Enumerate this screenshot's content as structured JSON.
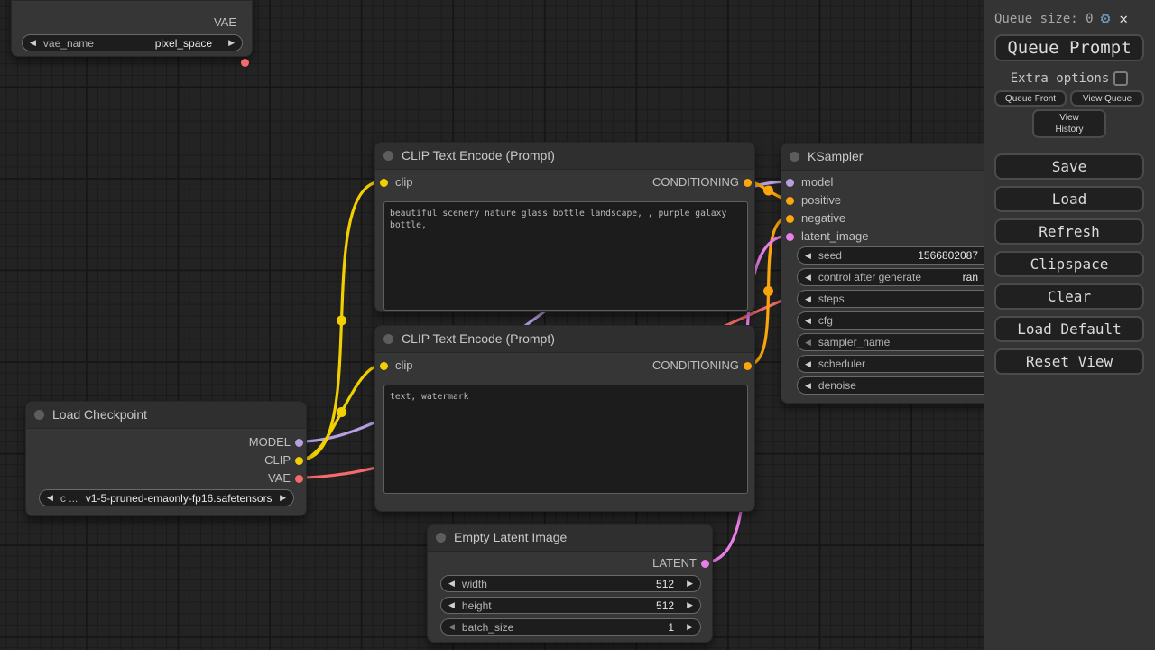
{
  "canvas": {
    "nodes": {
      "vae_loader": {
        "output_label": "VAE",
        "widget_label": "vae_name",
        "widget_value": "pixel_space"
      },
      "load_checkpoint": {
        "title": "Load Checkpoint",
        "output_model": "MODEL",
        "output_clip": "CLIP",
        "output_vae": "VAE",
        "widget_label": "c ...",
        "widget_value": "v1-5-pruned-emaonly-fp16.safetensors"
      },
      "clip_encode_positive": {
        "title": "CLIP Text Encode (Prompt)",
        "input_label": "clip",
        "output_label": "CONDITIONING",
        "text": "beautiful scenery nature glass bottle landscape, , purple galaxy bottle,"
      },
      "clip_encode_negative": {
        "title": "CLIP Text Encode (Prompt)",
        "input_label": "clip",
        "output_label": "CONDITIONING",
        "text": "text, watermark"
      },
      "ksampler": {
        "title": "KSampler",
        "inputs": [
          "model",
          "positive",
          "negative",
          "latent_image"
        ],
        "widgets": [
          {
            "label": "seed",
            "value": "1566802087"
          },
          {
            "label": "control after generate",
            "value": "ran"
          },
          {
            "label": "steps",
            "value": ""
          },
          {
            "label": "cfg",
            "value": ""
          },
          {
            "label": "sampler_name",
            "value": ""
          },
          {
            "label": "scheduler",
            "value": ""
          },
          {
            "label": "denoise",
            "value": ""
          }
        ]
      },
      "empty_latent": {
        "title": "Empty Latent Image",
        "output_label": "LATENT",
        "widgets": [
          {
            "label": "width",
            "value": "512"
          },
          {
            "label": "height",
            "value": "512"
          },
          {
            "label": "batch_size",
            "value": "1"
          }
        ]
      }
    },
    "slot_colors": {
      "model": "#b79fe0",
      "clip": "#f2d000",
      "vae": "#f56a6a",
      "conditioning": "#fba60b",
      "latent": "#e97fe9",
      "title_dot": "#5d5d5d"
    }
  },
  "sidebar": {
    "queue_size_label": "Queue size: 0",
    "queue_prompt": "Queue Prompt",
    "extra_options_label": "Extra options",
    "queue_front": "Queue Front",
    "view_queue": "View Queue",
    "view_history": "View History",
    "menu_buttons": [
      "Save",
      "Load",
      "Refresh",
      "Clipspace",
      "Clear",
      "Load Default",
      "Reset View"
    ]
  }
}
